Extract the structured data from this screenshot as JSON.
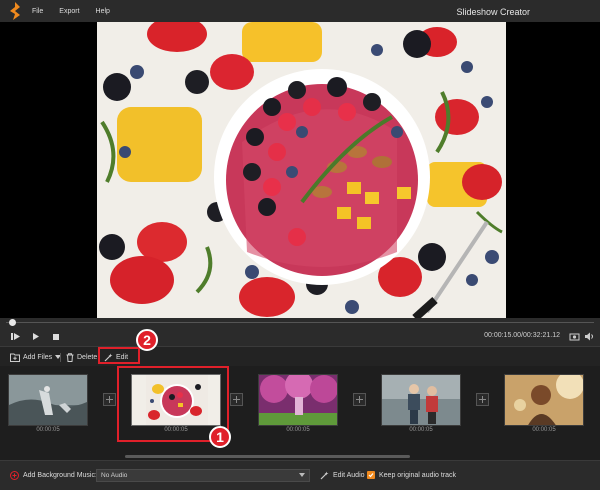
{
  "menu": {
    "file": "File",
    "export": "Export",
    "help": "Help"
  },
  "app_title": "Slideshow Creator",
  "player": {
    "timecode": "00:00:15.00/00:32:21.12",
    "progress": 0.0
  },
  "toolbar": {
    "add_files": "Add Files",
    "delete": "Delete",
    "edit": "Edit"
  },
  "clips": [
    {
      "duration": "00:00:05"
    },
    {
      "duration": "00:00:05"
    },
    {
      "duration": "00:00:05"
    },
    {
      "duration": "00:00:05"
    },
    {
      "duration": "00:00:05"
    }
  ],
  "annotations": {
    "badge_1": "1",
    "badge_2": "2"
  },
  "bottom": {
    "add_bg_music": "Add Background Music:",
    "audio_select": "No Audio",
    "edit_audio": "Edit Audio",
    "keep_audio": "Keep original audio track"
  },
  "colors": {
    "accent_red": "#e0202a",
    "checkbox_orange": "#f08a1e",
    "logo_orange": "#f08a1e"
  }
}
